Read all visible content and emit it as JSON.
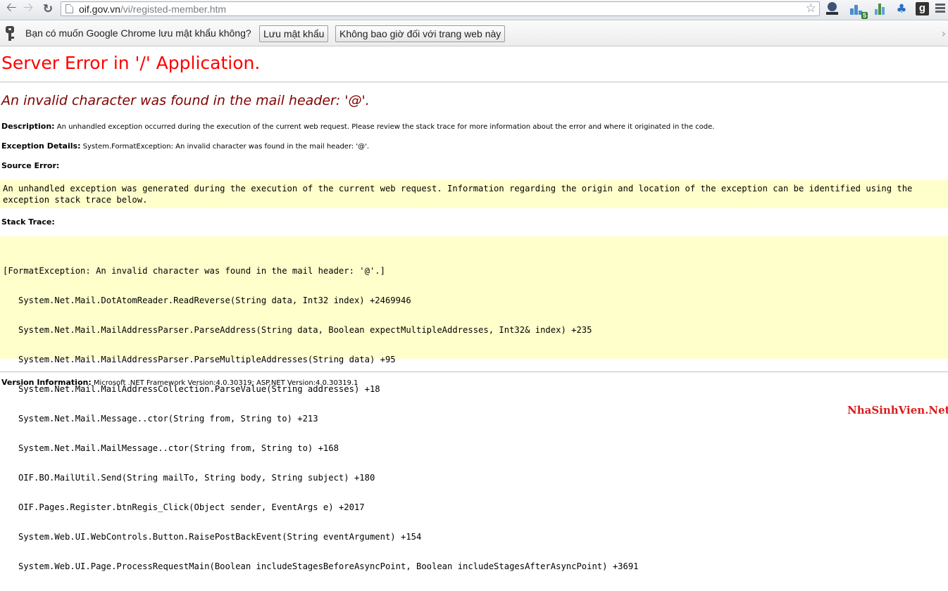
{
  "browser": {
    "url_host": "oif.gov.vn",
    "url_path": "/vi/registed-member.htm",
    "extension_badge": "5",
    "extension_letter": "g"
  },
  "infobar": {
    "prompt": "Bạn có muốn Google Chrome lưu mật khẩu không?",
    "save_label": "Lưu mật khẩu",
    "never_label": "Không bao giờ đối với trang web này"
  },
  "page": {
    "heading": "Server Error in '/' Application.",
    "error_message": "An invalid character was found in the mail header: '@'.",
    "description_label": "Description:",
    "description_text": " An unhandled exception occurred during the execution of the current web request. Please review the stack trace for more information about the error and where it originated in the code.",
    "exception_label": "Exception Details:",
    "exception_text": " System.FormatException: An invalid character was found in the mail header: '@'.",
    "source_error_label": "Source Error:",
    "source_error_text": "An unhandled exception was generated during the execution of the current web request. Information regarding the origin and location of the exception can be identified using the exception stack trace below.",
    "stack_trace_label": "Stack Trace:",
    "stack_trace_lines": [
      "[FormatException: An invalid character was found in the mail header: '@'.]",
      "   System.Net.Mail.DotAtomReader.ReadReverse(String data, Int32 index) +2469946",
      "   System.Net.Mail.MailAddressParser.ParseAddress(String data, Boolean expectMultipleAddresses, Int32& index) +235",
      "   System.Net.Mail.MailAddressParser.ParseMultipleAddresses(String data) +95",
      "   System.Net.Mail.MailAddressCollection.ParseValue(String addresses) +18",
      "   System.Net.Mail.Message..ctor(String from, String to) +213",
      "   System.Net.Mail.MailMessage..ctor(String from, String to) +168",
      "   OIF.BO.MailUtil.Send(String mailTo, String body, String subject) +180",
      "   OIF.Pages.Register.btnRegis_Click(Object sender, EventArgs e) +2017",
      "   System.Web.UI.WebControls.Button.RaisePostBackEvent(String eventArgument) +154",
      "   System.Web.UI.Page.ProcessRequestMain(Boolean includeStagesBeforeAsyncPoint, Boolean includeStagesAfterAsyncPoint) +3691"
    ],
    "version_label": "Version Information:",
    "version_text": " Microsoft .NET Framework Version:4.0.30319; ASP.NET Version:4.0.30319.1"
  },
  "watermark": "NhaSinhVien.Net",
  "colors": {
    "heading": "#ff0000",
    "error_message": "#800000",
    "code_background": "#ffffcc",
    "watermark": "#d81c1c"
  }
}
